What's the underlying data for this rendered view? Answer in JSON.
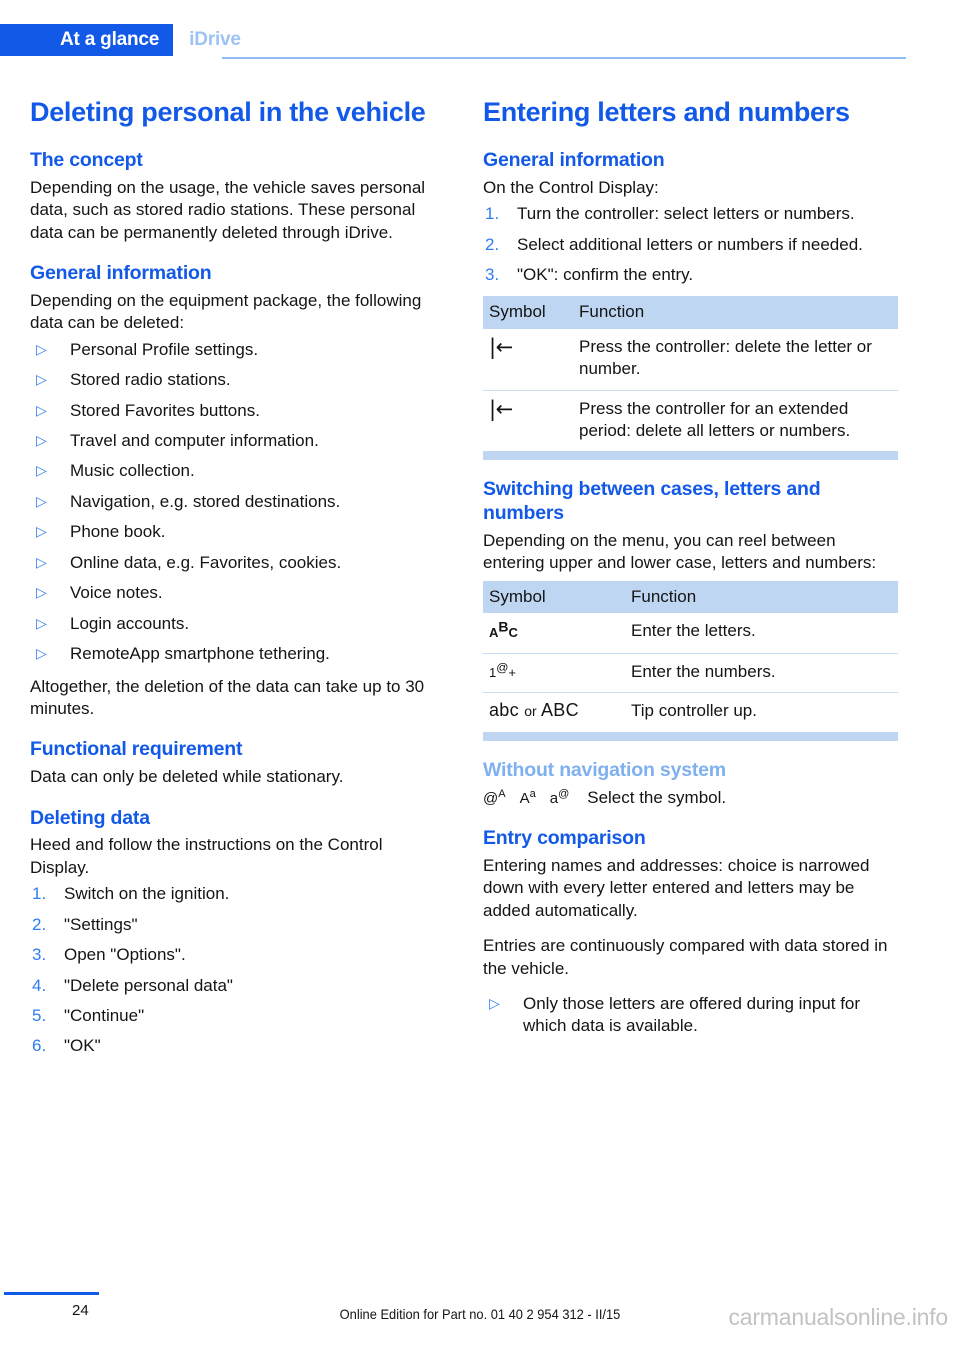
{
  "header": {
    "active_tab": "At a glance",
    "inactive_tab": "iDrive"
  },
  "left_column": {
    "chapter_title": "Deleting personal in the vehicle",
    "sections": [
      {
        "heading": "The concept",
        "paragraph": "Depending on the usage, the vehicle saves personal data, such as stored radio stations. These personal data can be permanently deleted through iDrive."
      },
      {
        "heading": "General information",
        "paragraph": "Depending on the equipment package, the following data can be deleted:",
        "bullets": [
          "Personal Profile settings.",
          "Stored radio stations.",
          "Stored Favorites buttons.",
          "Travel and computer information.",
          "Music collection.",
          "Navigation, e.g. stored destinations.",
          "Phone book.",
          "Online data, e.g. Favorites, cookies.",
          "Voice notes.",
          "Login accounts.",
          "RemoteApp smartphone tethering."
        ],
        "closing_paragraph": "Altogether, the deletion of the data can take up to 30 minutes."
      },
      {
        "heading": "Functional requirement",
        "paragraph": "Data can only be deleted while stationary."
      },
      {
        "heading": "Deleting data",
        "paragraph": "Heed and follow the instructions on the Control Display.",
        "steps": [
          "Switch on the ignition.",
          "\"Settings\"",
          "Open \"Options\".",
          "\"Delete personal data\"",
          "\"Continue\"",
          "\"OK\""
        ]
      }
    ]
  },
  "right_column": {
    "chapter_title": "Entering letters and numbers",
    "general_information": {
      "heading": "General information",
      "paragraph": "On the Control Display:",
      "steps": [
        "Turn the controller: select letters or numbers.",
        "Select additional letters or numbers if needed.",
        "\"OK\": confirm the entry."
      ]
    },
    "delete_table": {
      "col_symbol": "Symbol",
      "col_function": "Function",
      "rows": [
        {
          "symbol": "|←",
          "symbol_name": "backspace-icon",
          "function": "Press the controller: delete the letter or number."
        },
        {
          "symbol": "|←",
          "symbol_name": "backspace-icon",
          "function": "Press the controller for an extended period: delete all letters or numbers."
        }
      ]
    },
    "switching": {
      "heading": "Switching between cases, letters and numbers",
      "paragraph": "Depending on the menu, you can reel between entering upper and lower case, letters and numbers:"
    },
    "case_table": {
      "col_symbol": "Symbol",
      "col_function": "Function",
      "rows": [
        {
          "symbol_base": "A",
          "symbol_sup": "B",
          "symbol_tail": "C",
          "symbol_name": "letters-abc-icon",
          "function": "Enter the letters."
        },
        {
          "symbol_base": "1",
          "symbol_sup": "@",
          "symbol_tail": "+",
          "symbol_name": "numbers-icon",
          "function": "Enter the numbers."
        },
        {
          "symbol_lower": "abc",
          "symbol_or": "or",
          "symbol_upper": "ABC",
          "symbol_name": "case-toggle-icon",
          "function": "Tip controller up."
        }
      ]
    },
    "without_nav": {
      "heading": "Without navigation system",
      "symbols": [
        {
          "base": "@",
          "sup": "A",
          "name": "at-uppercase-icon"
        },
        {
          "base": "A",
          "sup": "a",
          "name": "upper-lower-icon"
        },
        {
          "base": "a",
          "sup": "@",
          "name": "lower-at-icon"
        }
      ],
      "text": "Select the symbol."
    },
    "entry_comparison": {
      "heading": "Entry comparison",
      "paragraph_1": "Entering names and addresses: choice is narrowed down with every letter entered and letters may be added automatically.",
      "paragraph_2": "Entries are continuously compared with data stored in the vehicle.",
      "bullets": [
        "Only those letters are offered during input for which data is available."
      ]
    }
  },
  "footer": {
    "page_number": "24",
    "edition_text": "Online Edition for Part no. 01 40 2 954 312 - II/15",
    "watermark": "carmanualsonline.info"
  },
  "colors": {
    "accent_blue": "#1259e8",
    "light_blue": "#7fb0ef",
    "table_header": "#bfd6f2",
    "table_divider": "#c9ddf5"
  }
}
